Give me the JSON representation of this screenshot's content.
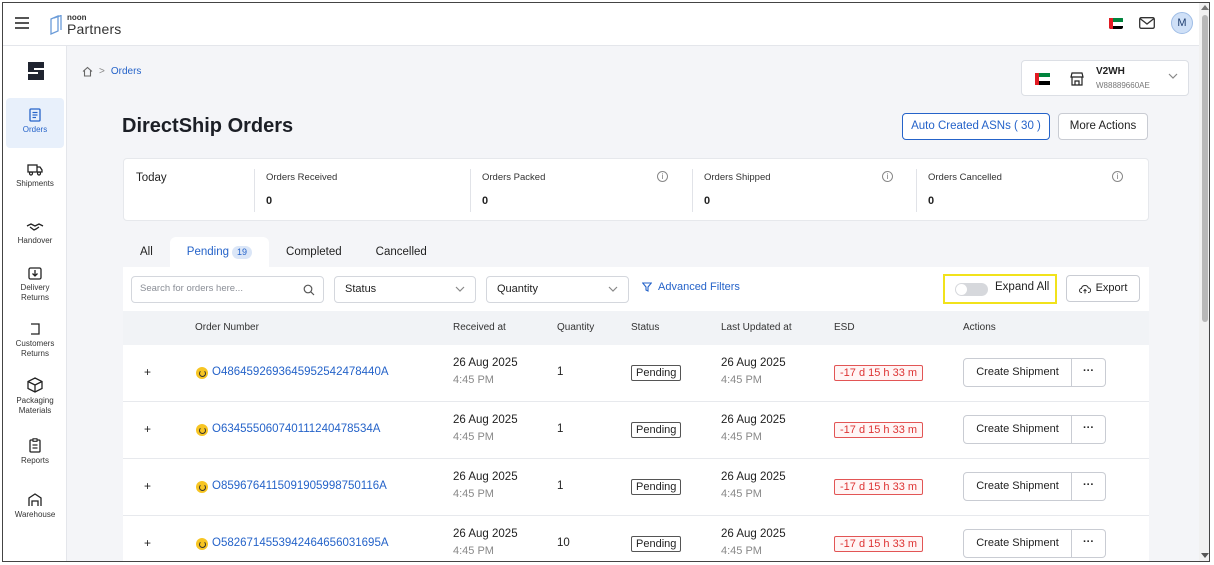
{
  "colors": {
    "accent": "#2563c9",
    "highlight": "#f1e21b",
    "danger": "#d33333"
  },
  "topbar": {
    "logo_small": "noon",
    "logo_text": "Partners",
    "avatar_initial": "M"
  },
  "sidebar": {
    "items": [
      {
        "label": "Orders",
        "icon": "orders-icon"
      },
      {
        "label": "Shipments",
        "icon": "truck-icon"
      },
      {
        "label": "Handover",
        "icon": "handshake-icon"
      },
      {
        "label": "Delivery Returns",
        "icon": "returns-icon"
      },
      {
        "label": "Customers Returns",
        "icon": "customer-returns-icon"
      },
      {
        "label": "Packaging Materials",
        "icon": "package-icon"
      },
      {
        "label": "Reports",
        "icon": "reports-icon"
      },
      {
        "label": "Warehouse",
        "icon": "warehouse-icon"
      }
    ]
  },
  "breadcrumb": {
    "current": "Orders"
  },
  "warehouse": {
    "name": "V2WH",
    "code": "W88889660AE"
  },
  "page": {
    "title": "DirectShip Orders",
    "asn_button": "Auto Created ASNs ( 30 )",
    "more_actions": "More Actions"
  },
  "stats": {
    "today_label": "Today",
    "items": [
      {
        "label": "Orders Received",
        "value": "0"
      },
      {
        "label": "Orders Packed",
        "value": "0"
      },
      {
        "label": "Orders Shipped",
        "value": "0"
      },
      {
        "label": "Orders Cancelled",
        "value": "0"
      }
    ]
  },
  "tabs": [
    {
      "label": "All"
    },
    {
      "label": "Pending",
      "count": "19"
    },
    {
      "label": "Completed"
    },
    {
      "label": "Cancelled"
    }
  ],
  "filters": {
    "search_placeholder": "Search for orders here...",
    "status": "Status",
    "quantity": "Quantity",
    "advanced": "Advanced Filters",
    "expand_all": "Expand All",
    "expand_all_on": false,
    "export": "Export"
  },
  "table": {
    "headers": [
      "Order Number",
      "Received at",
      "Quantity",
      "Status",
      "Last Updated at",
      "ESD",
      "Actions"
    ],
    "action_label": "Create Shipment",
    "action_more": "···",
    "expand_symbol": "+",
    "rows": [
      {
        "order": "O48645926936459525424784 40A",
        "received_date": "26 Aug 2025",
        "received_time": "4:45 PM",
        "quantity": "1",
        "status": "Pending",
        "updated_date": "26 Aug 2025",
        "updated_time": "4:45 PM",
        "esd": "-17 d 15 h 33 m"
      },
      {
        "order": "O63455506074011124047853 4A",
        "received_date": "26 Aug 2025",
        "received_time": "4:45 PM",
        "quantity": "1",
        "status": "Pending",
        "updated_date": "26 Aug 2025",
        "updated_time": "4:45 PM",
        "esd": "-17 d 15 h 33 m"
      },
      {
        "order": "O85967641150919059987501 16A",
        "received_date": "26 Aug 2025",
        "received_time": "4:45 PM",
        "quantity": "1",
        "status": "Pending",
        "updated_date": "26 Aug 2025",
        "updated_time": "4:45 PM",
        "esd": "-17 d 15 h 33 m"
      },
      {
        "order": "O58267145539424646560316 95A",
        "received_date": "26 Aug 2025",
        "received_time": "4:45 PM",
        "quantity": "10",
        "status": "Pending",
        "updated_date": "26 Aug 2025",
        "updated_time": "4:45 PM",
        "esd": "-17 d 15 h 33 m"
      }
    ]
  }
}
